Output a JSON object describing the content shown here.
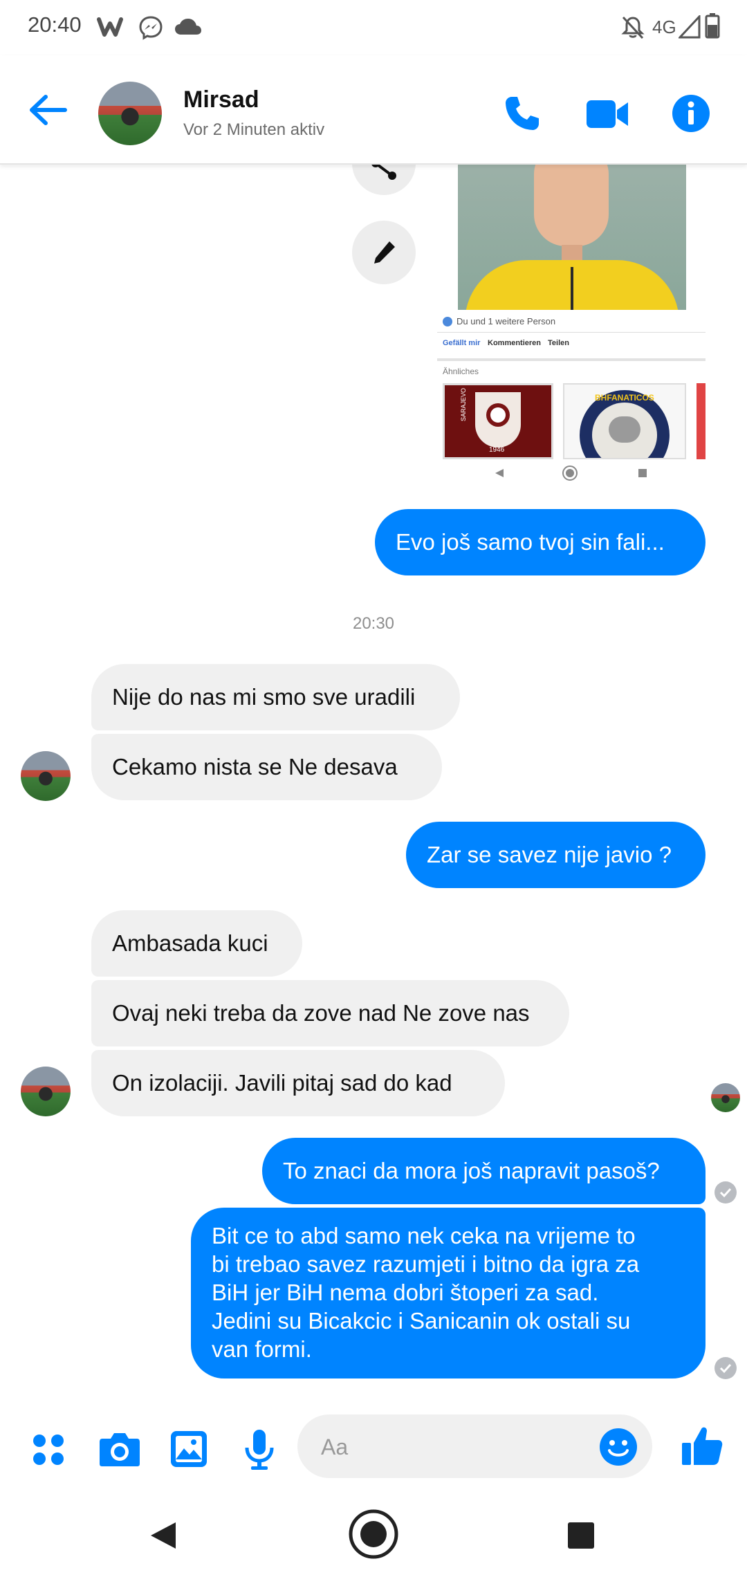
{
  "status_bar": {
    "time": "20:40",
    "network": "4G"
  },
  "header": {
    "contact_name": "Mirsad",
    "status": "Vor 2 Minuten aktiv"
  },
  "shared_screenshot": {
    "likes": "Du und 1 weitere Person",
    "actions": [
      "Gefällt mir",
      "Kommentieren",
      "Teilen"
    ],
    "similar_label": "Ähnliches",
    "badge_year": "1946",
    "badge_text": "SARAJEVO",
    "badge2_text": "BHFANATICOS"
  },
  "messages": [
    {
      "dir": "out",
      "text": "Evo još samo tvoj sin fali..."
    },
    {
      "dir": "stamp",
      "text": "20:30"
    },
    {
      "dir": "in",
      "text": "Nije do nas mi smo sve uradili"
    },
    {
      "dir": "in",
      "text": "Cekamo  nista se Ne desava"
    },
    {
      "dir": "out",
      "text": "Zar se savez nije javio ?"
    },
    {
      "dir": "in",
      "text": "Ambasada kuci"
    },
    {
      "dir": "in",
      "text": "Ovaj neki treba da zove nad Ne zove nas"
    },
    {
      "dir": "in",
      "text": "On izolaciji. Javili  pitaj sad do kad"
    },
    {
      "dir": "out",
      "text": "To znaci da mora još napravit pasoš?"
    },
    {
      "dir": "out",
      "lines": [
        "Bit ce to abd samo nek ceka na vrijeme to",
        "bi trebao savez razumjeti i bitno da igra za",
        "BiH jer BiH nema dobri štoperi za sad.",
        "Jedini su Bicakcic i Sanicanin ok ostali su",
        "van formi."
      ]
    }
  ],
  "composer": {
    "placeholder": "Aa"
  },
  "colors": {
    "accent": "#0084ff",
    "incoming_bubble": "#f0f0f0",
    "read_check": "#b9bcc1",
    "jersey": "#f2cf1f"
  },
  "icons": [
    "back-arrow-icon",
    "phone-icon",
    "video-camera-icon",
    "info-icon",
    "apps-icon",
    "camera-icon",
    "gallery-icon",
    "microphone-icon",
    "emoji-icon",
    "thumbs-up-icon",
    "share-icon",
    "edit-pencil-icon"
  ]
}
